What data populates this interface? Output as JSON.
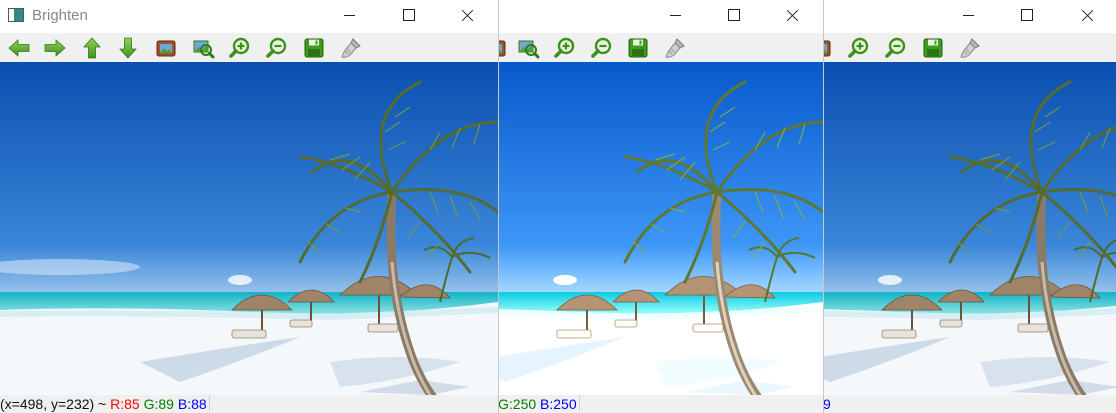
{
  "windows": [
    {
      "title": "Brighten",
      "status": {
        "coords": "(x=498, y=232) ~",
        "r": "R:85",
        "g": "G:89",
        "b": "B:88"
      }
    },
    {
      "title": "",
      "status": {
        "g": "G:250",
        "b": "B:250"
      }
    },
    {
      "title": "",
      "status": {
        "b": "9"
      }
    }
  ],
  "toolbar": {
    "icons": [
      "arrow-left-icon",
      "arrow-right-icon",
      "arrow-up-icon",
      "arrow-down-icon",
      "image-icon",
      "zoom-fit-icon",
      "zoom-in-icon",
      "zoom-out-icon",
      "save-icon",
      "brush-icon"
    ]
  },
  "colors": {
    "status_red": "#ff0000",
    "status_green": "#008000",
    "status_blue": "#0000ff",
    "icon_green": "#4aa02c"
  }
}
